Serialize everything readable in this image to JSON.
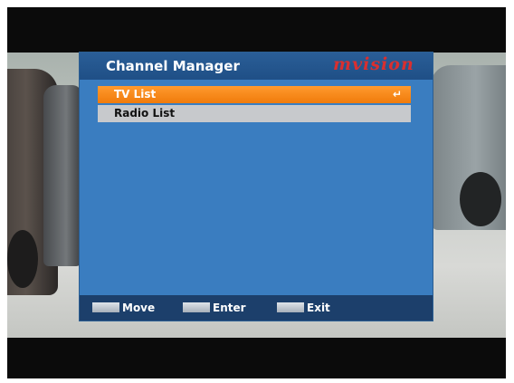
{
  "dialog": {
    "title": "Channel Manager",
    "brand": "mvision"
  },
  "list": {
    "items": [
      {
        "label": "TV List",
        "selected": true
      },
      {
        "label": "Radio List",
        "selected": false
      }
    ],
    "enter_icon_glyph": "↵"
  },
  "footer": {
    "hints": [
      {
        "label": "Move",
        "icon": "arrow-keys-icon"
      },
      {
        "label": "Enter",
        "icon": "ok-key-icon"
      },
      {
        "label": "Exit",
        "icon": "exit-key-icon"
      }
    ]
  },
  "colors": {
    "panel": "#3a7dc0",
    "header": "#1f4f86",
    "selected": "#f07b0b",
    "item": "#c7c9cc",
    "footer": "#1c3f6b",
    "brand": "#d92f2f"
  }
}
